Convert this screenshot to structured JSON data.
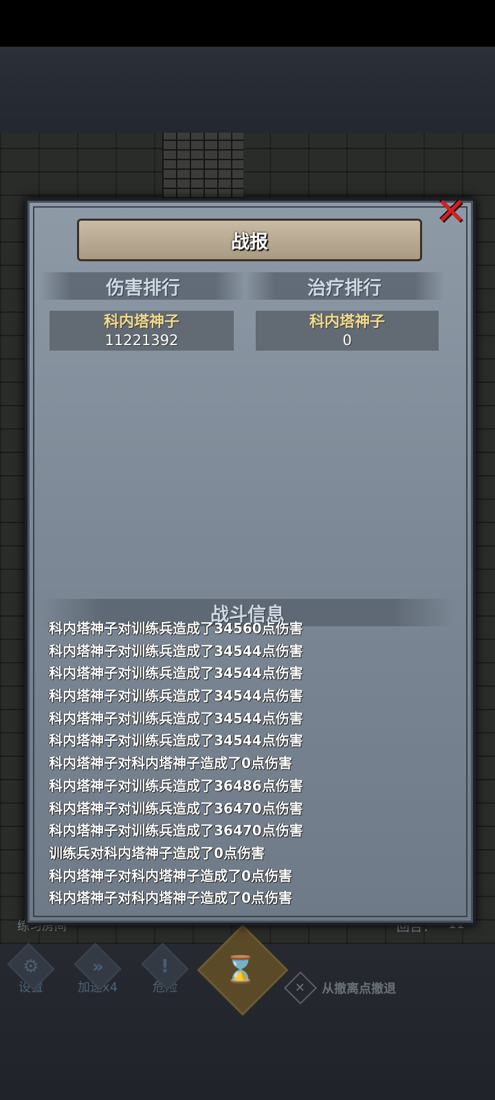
{
  "modal": {
    "title": "战报",
    "close_icon": "close-x-icon"
  },
  "damage_rank": {
    "header": "伤害排行",
    "name": "科内塔神子",
    "value": "11221392"
  },
  "heal_rank": {
    "header": "治疗排行",
    "name": "科内塔神子",
    "value": "0"
  },
  "battle_info": {
    "header": "战斗信息",
    "lines": [
      "科内塔神子对训练兵造成了34560点伤害",
      "科内塔神子对训练兵造成了34544点伤害",
      "科内塔神子对训练兵造成了34544点伤害",
      "科内塔神子对训练兵造成了34544点伤害",
      "科内塔神子对训练兵造成了34544点伤害",
      "科内塔神子对训练兵造成了34544点伤害",
      "科内塔神子对科内塔神子造成了0点伤害",
      "科内塔神子对训练兵造成了36486点伤害",
      "科内塔神子对训练兵造成了36470点伤害",
      "科内塔神子对训练兵造成了36470点伤害",
      "训练兵对科内塔神子造成了0点伤害",
      "科内塔神子对科内塔神子造成了0点伤害",
      "科内塔神子对科内塔神子造成了0点伤害"
    ]
  },
  "footer": {
    "room": "练习房间",
    "round_label": "回合：",
    "round_value": "11"
  },
  "toolbar": {
    "settings_label": "设置",
    "speed_label": "加速x4",
    "danger_label": "危险",
    "retreat_label": "从撤离点撤退"
  },
  "colors": {
    "rank_name": "#f4dc8d",
    "close_red": "#d61f1f",
    "hourglass": "#a6854a"
  }
}
